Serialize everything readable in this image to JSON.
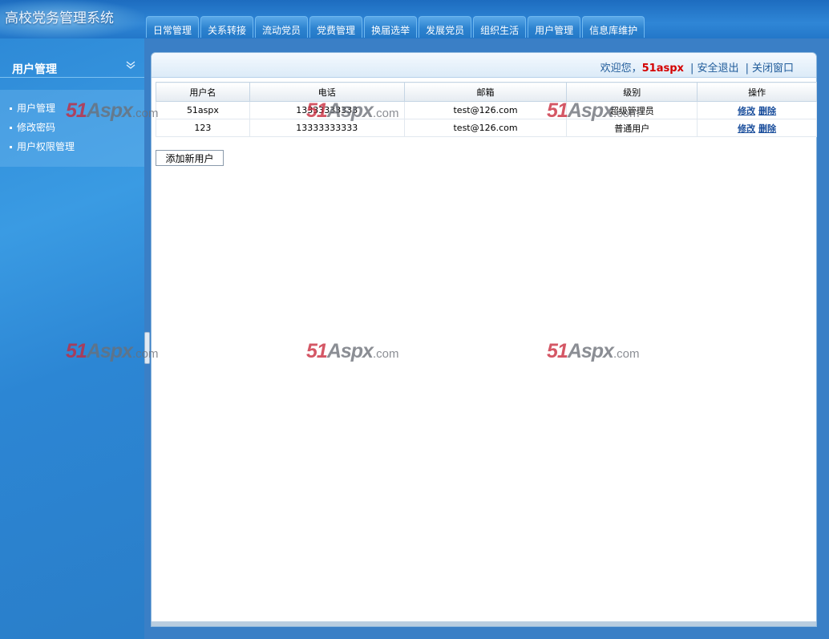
{
  "app": {
    "title": "高校党务管理系统"
  },
  "nav": {
    "tabs": [
      "日常管理",
      "关系转接",
      "流动党员",
      "党费管理",
      "换届选举",
      "发展党员",
      "组织生活",
      "用户管理",
      "信息库维护"
    ]
  },
  "sidebar": {
    "title": "用户管理",
    "items": [
      "用户管理",
      "修改密码",
      "用户权限管理"
    ]
  },
  "topbar": {
    "welcome": "欢迎您，",
    "user": "51aspx",
    "sep": "|",
    "logout": "安全退出",
    "close": "关闭窗口"
  },
  "table": {
    "headers": [
      "用户名",
      "电话",
      "邮箱",
      "级别",
      "操作"
    ],
    "rows": [
      {
        "name": "51aspx",
        "phone": "13333333333",
        "email": "test@126.com",
        "level": "超级管理员"
      },
      {
        "name": "123",
        "phone": "13333333333",
        "email": "test@126.com",
        "level": "普通用户"
      }
    ],
    "edit_label": "修改",
    "delete_label": "删除"
  },
  "actions": {
    "add_user": "添加新用户"
  },
  "watermark": {
    "part1": "51",
    "part2": "Aspx",
    "part3": ".com"
  },
  "colors": {
    "accent": "#2d83d0",
    "user_highlight": "#d40000",
    "link": "#1a4e9c"
  }
}
